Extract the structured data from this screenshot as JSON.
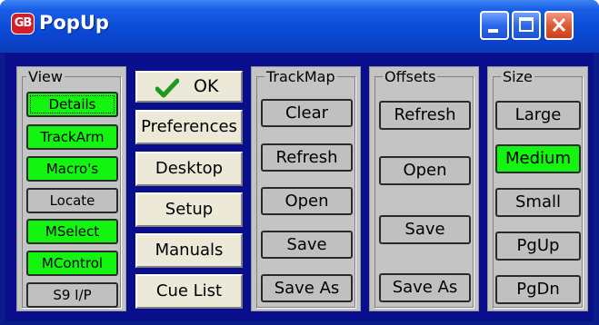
{
  "window": {
    "title": "PopUp",
    "icon_label": "GB",
    "buttons": {
      "minimize": "minimize-icon",
      "maximize": "maximize-icon",
      "close": "close-icon"
    }
  },
  "colors": {
    "active_green": "#13f510",
    "client_background": "#080e8c",
    "group_gray": "#c4c4c4",
    "button_face": "#ece9d8",
    "titlebar_blue": "#0a4ad6",
    "close_red": "#e05a34"
  },
  "view": {
    "label": "View",
    "items": [
      {
        "label": "Details",
        "active": true,
        "focused": true
      },
      {
        "label": "TrackArm",
        "active": true
      },
      {
        "label": "Macro's",
        "active": true
      },
      {
        "label": "Locate",
        "active": false
      },
      {
        "label": "MSelect",
        "active": true
      },
      {
        "label": "MControl",
        "active": true
      },
      {
        "label": "S9 I/P",
        "active": false
      }
    ]
  },
  "actions": {
    "ok": {
      "label": "OK",
      "icon": "checkmark-icon"
    },
    "preferences": "Preferences",
    "desktop": "Desktop",
    "setup": "Setup",
    "manuals": "Manuals",
    "cue_list": "Cue List"
  },
  "trackmap": {
    "label": "TrackMap",
    "items": [
      "Clear",
      "Refresh",
      "Open",
      "Save",
      "Save As"
    ]
  },
  "offsets": {
    "label": "Offsets",
    "items": [
      "Refresh",
      "Open",
      "Save",
      "Save As"
    ]
  },
  "size": {
    "label": "Size",
    "items": [
      {
        "label": "Large",
        "active": false
      },
      {
        "label": "Medium",
        "active": true
      },
      {
        "label": "Small",
        "active": false
      },
      {
        "label": "PgUp",
        "active": false
      },
      {
        "label": "PgDn",
        "active": false
      }
    ]
  }
}
